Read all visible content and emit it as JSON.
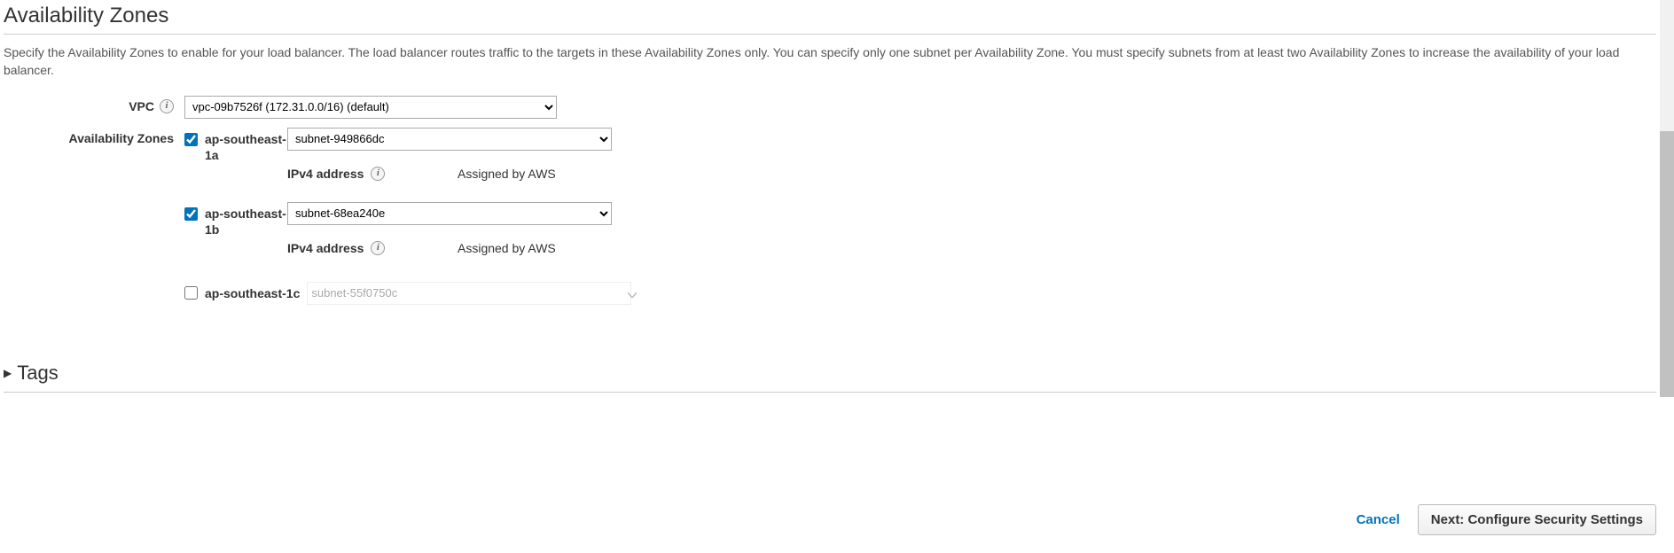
{
  "section": {
    "title": "Availability Zones",
    "description": "Specify the Availability Zones to enable for your load balancer. The load balancer routes traffic to the targets in these Availability Zones only. You can specify only one subnet per Availability Zone. You must specify subnets from at least two Availability Zones to increase the availability of your load balancer."
  },
  "vpc": {
    "label": "VPC",
    "selected": "vpc-09b7526f (172.31.0.0/16) (default)"
  },
  "az": {
    "label": "Availability Zones",
    "ipv4_label": "IPv4 address",
    "assigned_text": "Assigned by AWS",
    "zones": [
      {
        "name": "ap-southeast-1a",
        "checked": true,
        "subnet": "subnet-949866dc"
      },
      {
        "name": "ap-southeast-1b",
        "checked": true,
        "subnet": "subnet-68ea240e"
      },
      {
        "name": "ap-southeast-1c",
        "checked": false,
        "subnet": "subnet-55f0750c"
      }
    ]
  },
  "tags": {
    "title": "Tags"
  },
  "footer": {
    "cancel": "Cancel",
    "next": "Next: Configure Security Settings"
  }
}
